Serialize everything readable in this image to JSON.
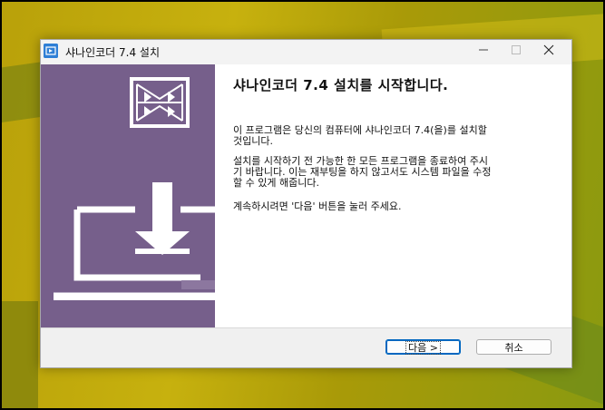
{
  "window": {
    "title": "샤나인코더 7.4 설치",
    "icon_name": "installer-app-icon",
    "minimize_label": "—",
    "maximize_label": "☐",
    "close_label": "✕"
  },
  "content": {
    "heading": "샤나인코더 7.4 설치를 시작합니다.",
    "paragraph1_line1": "이 프로그램은 당신의 컴퓨터에 샤나인코더 7.4(을)를 설치할",
    "paragraph1_line2": "것입니다.",
    "paragraph2_line1": "설치를 시작하기 전 가능한 한 모든 프로그램을 종료하여 주시",
    "paragraph2_line2": "기 바랍니다. 이는 재부팅을 하지 않고서도 시스템 파일을 수정",
    "paragraph2_line3": "할 수 있게 해줍니다.",
    "paragraph3": "계속하시려면 '다음' 버튼을 눌러 주세요."
  },
  "buttons": {
    "next_label": "다음 >",
    "cancel_label": "취소"
  },
  "colors": {
    "sidebar": "#765f8b",
    "accent": "#0067c0"
  }
}
